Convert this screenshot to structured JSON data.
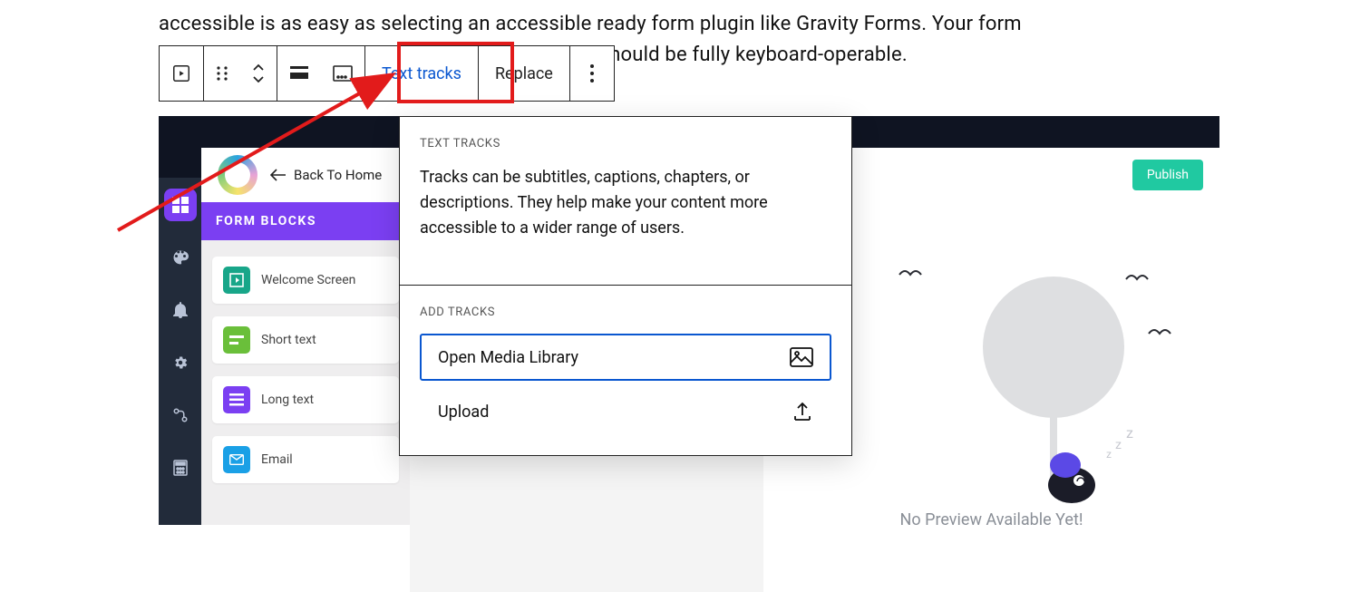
{
  "article": {
    "line1": "accessible is as easy as selecting an accessible ready form plugin like Gravity Forms. Your form",
    "line2_tail": " should be fully keyboard-operable."
  },
  "toolbar": {
    "text_tracks": "Text tracks",
    "replace": "Replace"
  },
  "popover": {
    "heading": "TEXT TRACKS",
    "body": "Tracks can be subtitles, captions, chapters, or descriptions. They help make your content more accessible to a wider range of users.",
    "add_heading": "ADD TRACKS",
    "open_media": "Open Media Library",
    "upload": "Upload"
  },
  "app": {
    "back": "Back To Home",
    "publish": "Publish",
    "panel_title": "FORM BLOCKS",
    "blocks": {
      "welcome": "Welcome Screen",
      "short": "Short text",
      "long": "Long text",
      "email": "Email"
    },
    "no_preview": "No Preview Available Yet!"
  },
  "colors": {
    "highlight": "#e21b1b",
    "active_link": "#0a57d0",
    "brand_purple": "#7b3ff2",
    "publish": "#20c9a1"
  }
}
